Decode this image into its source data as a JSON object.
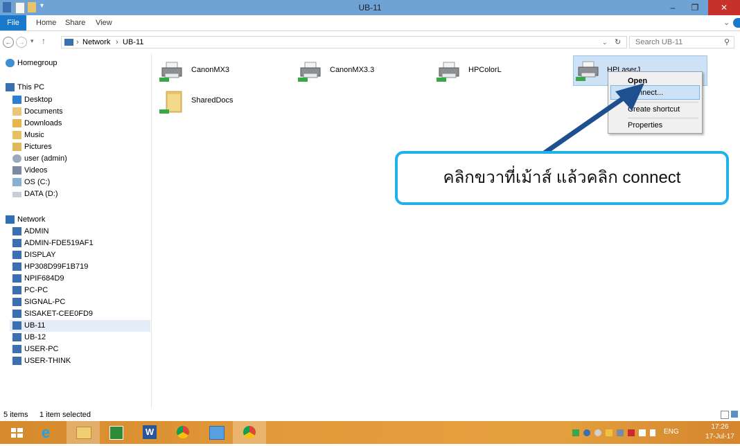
{
  "window": {
    "title": "UB-11"
  },
  "ribbon": {
    "tabs": [
      "File",
      "Home",
      "Share",
      "View"
    ]
  },
  "address": {
    "segments": [
      "Network",
      "UB-11"
    ],
    "search_placeholder": "Search UB-11"
  },
  "nav": {
    "homegroup": "Homegroup",
    "this_pc": "This PC",
    "pc_items": [
      "Desktop",
      "Documents",
      "Downloads",
      "Music",
      "Pictures",
      "user (admin)",
      "Videos",
      "OS (C:)",
      "DATA (D:)"
    ],
    "network": "Network",
    "network_items": [
      "ADMIN",
      "ADMIN-FDE519AF1",
      "DISPLAY",
      "HP308D99F1B719",
      "NPIF684D9",
      "PC-PC",
      "SIGNAL-PC",
      "SISAKET-CEE0FD9",
      "UB-11",
      "UB-12",
      "USER-PC",
      "USER-THINK"
    ]
  },
  "content": {
    "items": [
      "CanonMX3",
      "CanonMX3.3",
      "HPColorL",
      "HPLaserJ",
      "SharedDocs"
    ]
  },
  "context_menu": {
    "items": [
      "Open",
      "Connect...",
      "Create shortcut",
      "Properties"
    ]
  },
  "callout": {
    "text": "คลิกขวาที่เม้าส์ แล้วคลิก connect"
  },
  "status": {
    "count": "5 items",
    "selected": "1 item selected"
  },
  "taskbar": {
    "lang": "ENG",
    "time": "17:26",
    "date": "17-Jul-17"
  },
  "colors": {
    "accent": "#1979ca",
    "callout_border": "#1fb2e8",
    "arrow": "#1e4f8f",
    "taskbar": "#e39a3a"
  }
}
